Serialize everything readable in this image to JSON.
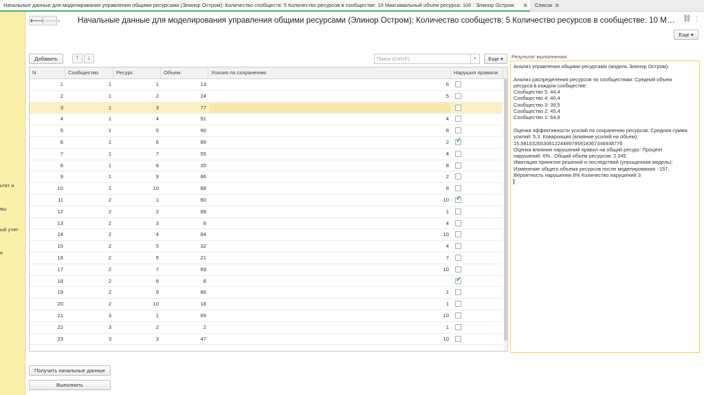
{
  "tabs": [
    {
      "label": "Начальные данные для моделирования управления общими ресурсами (Элинор Остром):  Количество сообществ: 5 Количество ресурсов в сообществе: 10 Максимальный объем ресурса: 100  : Элинор Остром",
      "active": true
    },
    {
      "label": "Список",
      "active": false
    }
  ],
  "sidebar": {
    "items": [
      "ьтат и",
      "вы",
      "ый учет",
      "е"
    ]
  },
  "header": {
    "title": "Начальные данные для моделирования управления общими ресурсами (Элинор Остром): Количество сообществ: 5 Количество ресурсов в сообществе: 10 Максима...",
    "more_label": "Еще",
    "more_icon": "chevron-down-icon",
    "link_icon": "link-icon",
    "menu_icon": "vertical-dots-icon"
  },
  "toolbar": {
    "add_label": "Добавить",
    "search_placeholder": "Поиск (Ctrl+F)",
    "search_clear": "×",
    "more_label": "Еще"
  },
  "table": {
    "columns": [
      "N",
      "Сообщество",
      "Ресурс",
      "Объем",
      "Усилия по сохранению",
      "Нарушил правила"
    ],
    "rows": [
      {
        "n": "1",
        "community": "1",
        "resource": "1",
        "volume": "13",
        "effort": "6",
        "violated": false
      },
      {
        "n": "2",
        "community": "1",
        "resource": "2",
        "volume": "24",
        "effort": "5",
        "violated": false
      },
      {
        "n": "3",
        "community": "1",
        "resource": "3",
        "volume": "77",
        "effort": "",
        "violated": false,
        "selected": true
      },
      {
        "n": "4",
        "community": "1",
        "resource": "4",
        "volume": "91",
        "effort": "4",
        "violated": false
      },
      {
        "n": "5",
        "community": "1",
        "resource": "5",
        "volume": "90",
        "effort": "8",
        "violated": false
      },
      {
        "n": "6",
        "community": "1",
        "resource": "6",
        "volume": "89",
        "effort": "2",
        "violated": true
      },
      {
        "n": "7",
        "community": "1",
        "resource": "7",
        "volume": "55",
        "effort": "4",
        "violated": false
      },
      {
        "n": "8",
        "community": "1",
        "resource": "8",
        "volume": "35",
        "effort": "8",
        "violated": false
      },
      {
        "n": "9",
        "community": "1",
        "resource": "9",
        "volume": "86",
        "effort": "2",
        "violated": false
      },
      {
        "n": "10",
        "community": "1",
        "resource": "10",
        "volume": "88",
        "effort": "8",
        "violated": false
      },
      {
        "n": "11",
        "community": "2",
        "resource": "1",
        "volume": "60",
        "effort": "10",
        "violated": true
      },
      {
        "n": "12",
        "community": "2",
        "resource": "2",
        "volume": "68",
        "effort": "1",
        "violated": false
      },
      {
        "n": "13",
        "community": "2",
        "resource": "3",
        "volume": "8",
        "effort": "4",
        "violated": false
      },
      {
        "n": "14",
        "community": "2",
        "resource": "4",
        "volume": "84",
        "effort": "10",
        "violated": false
      },
      {
        "n": "15",
        "community": "2",
        "resource": "5",
        "volume": "32",
        "effort": "4",
        "violated": false
      },
      {
        "n": "16",
        "community": "2",
        "resource": "6",
        "volume": "21",
        "effort": "7",
        "violated": false
      },
      {
        "n": "17",
        "community": "2",
        "resource": "7",
        "volume": "69",
        "effort": "10",
        "violated": false
      },
      {
        "n": "18",
        "community": "2",
        "resource": "8",
        "volume": "8",
        "effort": "",
        "violated": true
      },
      {
        "n": "19",
        "community": "2",
        "resource": "9",
        "volume": "86",
        "effort": "1",
        "violated": false
      },
      {
        "n": "20",
        "community": "2",
        "resource": "10",
        "volume": "18",
        "effort": "1",
        "violated": false
      },
      {
        "n": "21",
        "community": "3",
        "resource": "1",
        "volume": "69",
        "effort": "10",
        "violated": false
      },
      {
        "n": "22",
        "community": "3",
        "resource": "2",
        "volume": "2",
        "effort": "1",
        "violated": false
      },
      {
        "n": "23",
        "community": "3",
        "resource": "3",
        "volume": "47",
        "effort": "10",
        "violated": false
      }
    ]
  },
  "result": {
    "label": "Результат выполнения:",
    "lines": [
      "Анализ управления общими ресурсами (модель Элинор Остром):",
      "",
      "Анализ распределения ресурсов по сообществам: Средний объем",
      "ресурса в каждом сообществе:",
      "Сообщество 5: 44,4",
      "Сообщество 4: 40,4",
      "Сообщество 3: 39,5",
      "Сообщество 2: 45,4",
      "Сообщество 1: 64,8",
      "",
      "Оценка эффективности усилий по сохранению ресурсов: Средняя сумма",
      "усилий: 5,3. Ковариация (влияние усилий на объем):",
      "15,58163265306122448979591836734693877б",
      "Оценка влияния нарушений правил на общий ресурс: Процент",
      "нарушений: 6%.  Общий объем ресурсов: 2 345",
      "Имитация принятия решений и последствий (упрощенная модель):",
      "Изменение общего объема ресурсов после моделирования: -157.",
      "Вероятность нарушения 8% Количество нарушений 3"
    ]
  },
  "bottom": {
    "get_data_label": "Получить начальные данные",
    "run_label": "Выполнить"
  }
}
